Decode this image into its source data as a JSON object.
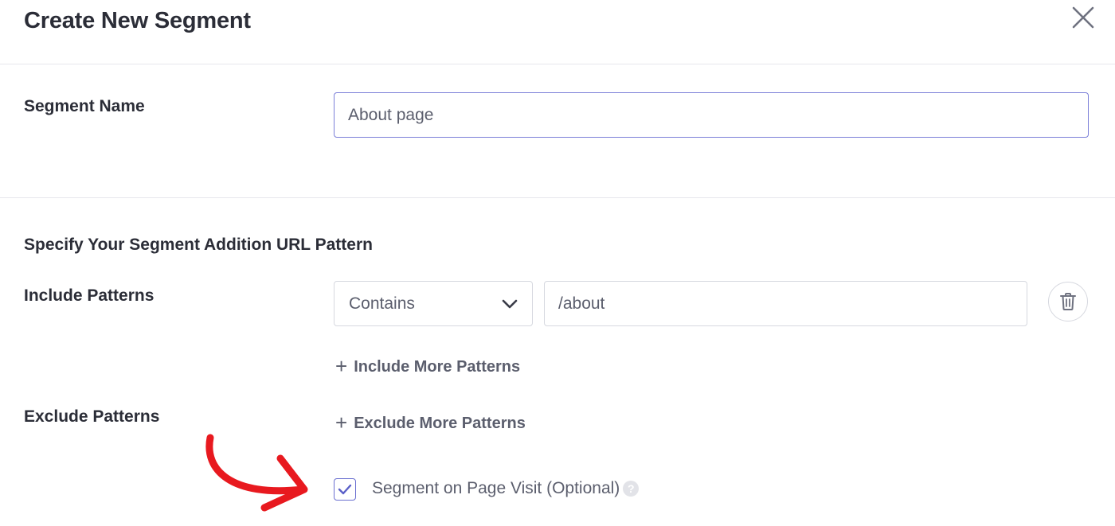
{
  "modal": {
    "title": "Create New Segment",
    "close_icon": "close-icon"
  },
  "segment_name": {
    "label": "Segment Name",
    "value": "About page"
  },
  "url_pattern": {
    "heading": "Specify Your Segment Addition URL Pattern",
    "include": {
      "label": "Include Patterns",
      "match_type": "Contains",
      "value": "/about",
      "add_more_label": "Include More Patterns",
      "delete_icon": "trash-icon"
    },
    "exclude": {
      "label": "Exclude Patterns",
      "add_more_label": "Exclude More Patterns"
    }
  },
  "page_visit": {
    "label": "Segment on Page Visit (Optional)",
    "checked": true,
    "help_icon": "help-icon"
  },
  "annotation": {
    "icon": "red-arrow-icon",
    "color": "#e8191f"
  },
  "colors": {
    "accent": "#6a6fd0",
    "text_dark": "#2b2d37",
    "text_muted": "#5b5e6d",
    "border": "#d6d8df"
  }
}
